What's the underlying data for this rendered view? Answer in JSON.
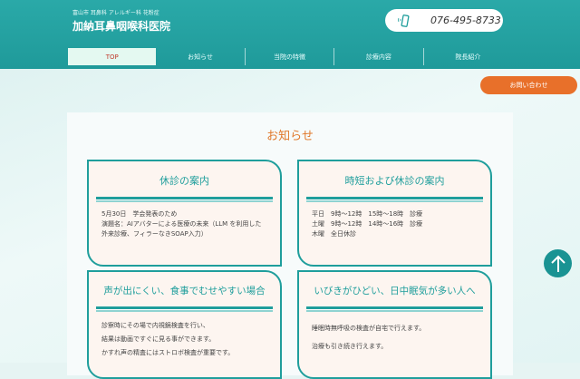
{
  "header": {
    "tagline": "富山市 耳鼻科 アレルギー科 花粉症",
    "clinic_name": "加納耳鼻咽喉科医院",
    "phone": "076-495-8733"
  },
  "nav": [
    "TOP",
    "お知らせ",
    "当院の特徴",
    "診療内容",
    "院長紹介"
  ],
  "contact_label": "お問い合わせ",
  "news": {
    "title": "お知らせ",
    "cards": [
      {
        "title": "休診の案内",
        "lines": [
          "5月30日　学会発表のため",
          "演題名：AIアバターによる医療の未来（LLM を利用した外来診療、フィラーなきSOAP入力）"
        ]
      },
      {
        "title": "時短および休診の案内",
        "lines": [
          "平日　9時～12時　15時～18時　診療",
          "土曜　9時～12時　14時～16時　診療",
          "木曜　全日休診"
        ]
      },
      {
        "title": "声が出にくい、食事でむせやすい場合",
        "lines": [
          "診察時にその場で内視鏡検査を行い、",
          "結果は動画ですぐに見る事ができます。",
          "かすれ声の精査にはストロボ検査が重要です。"
        ]
      },
      {
        "title": "いびきがひどい、日中眠気が多い人へ",
        "lines": [
          "睡眠時無呼吸の検査が自宅で行えます。",
          "治療も引き続き行えます。"
        ]
      }
    ]
  },
  "colors": {
    "teal": "#1f9e9c",
    "orange": "#e8702a",
    "accent_red": "#c0392b"
  }
}
